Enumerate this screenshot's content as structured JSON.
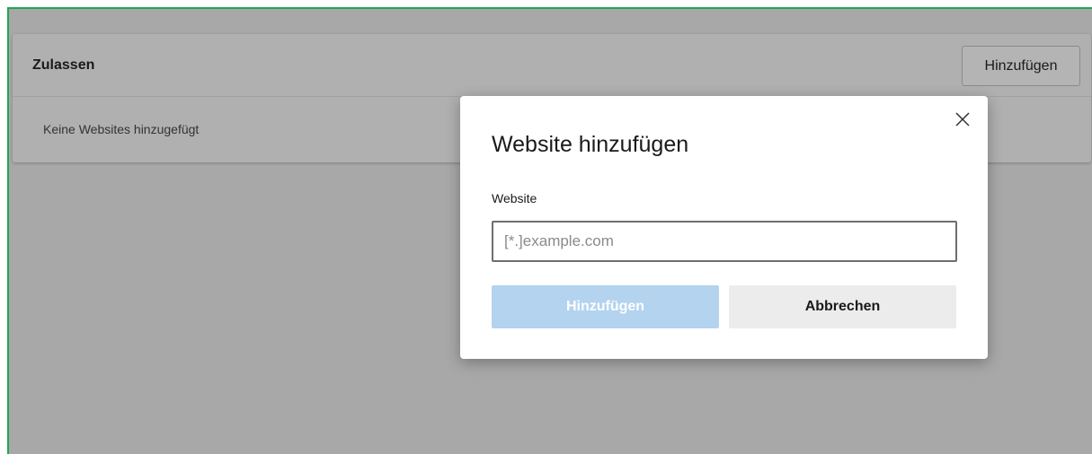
{
  "allow_section": {
    "title": "Zulassen",
    "add_button_label": "Hinzufügen",
    "empty_text": "Keine Websites hinzugefügt"
  },
  "dialog": {
    "title": "Website hinzufügen",
    "field_label": "Website",
    "input_value": "",
    "input_placeholder": "[*.]example.com",
    "add_button_label": "Hinzufügen",
    "cancel_button_label": "Abbrechen",
    "close_icon": "close-icon"
  },
  "colors": {
    "frame_border": "#1da851",
    "overlay": "#a8a8a8",
    "primary_disabled": "#b3d3ef",
    "secondary": "#ececec"
  }
}
